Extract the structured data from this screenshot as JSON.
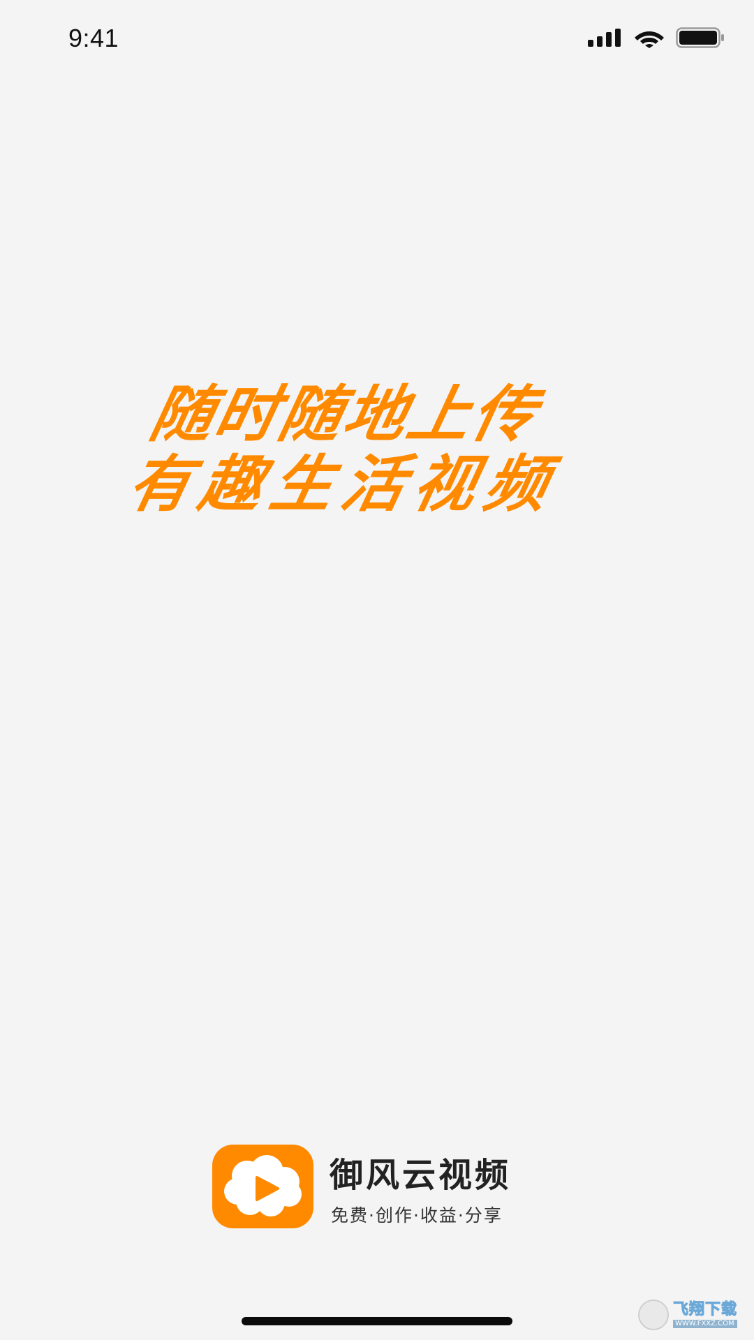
{
  "status_bar": {
    "time": "9:41",
    "icons": [
      "signal-icon",
      "wifi-icon",
      "battery-icon"
    ]
  },
  "slogan": {
    "line1": "随时随地上传",
    "line2": "有趣生活视频",
    "color": "#ff8a00"
  },
  "brand": {
    "logo_icon": "play-cloud-icon",
    "name": "御风云视频",
    "tagline": "免费·创作·收益·分享",
    "accent_color": "#ff8a00"
  },
  "watermark": {
    "title": "飞翔下载",
    "url": "WWW.FXXZ.COM"
  },
  "colors": {
    "background": "#f4f4f4",
    "accent": "#ff8a00",
    "text_dark": "#222222"
  }
}
